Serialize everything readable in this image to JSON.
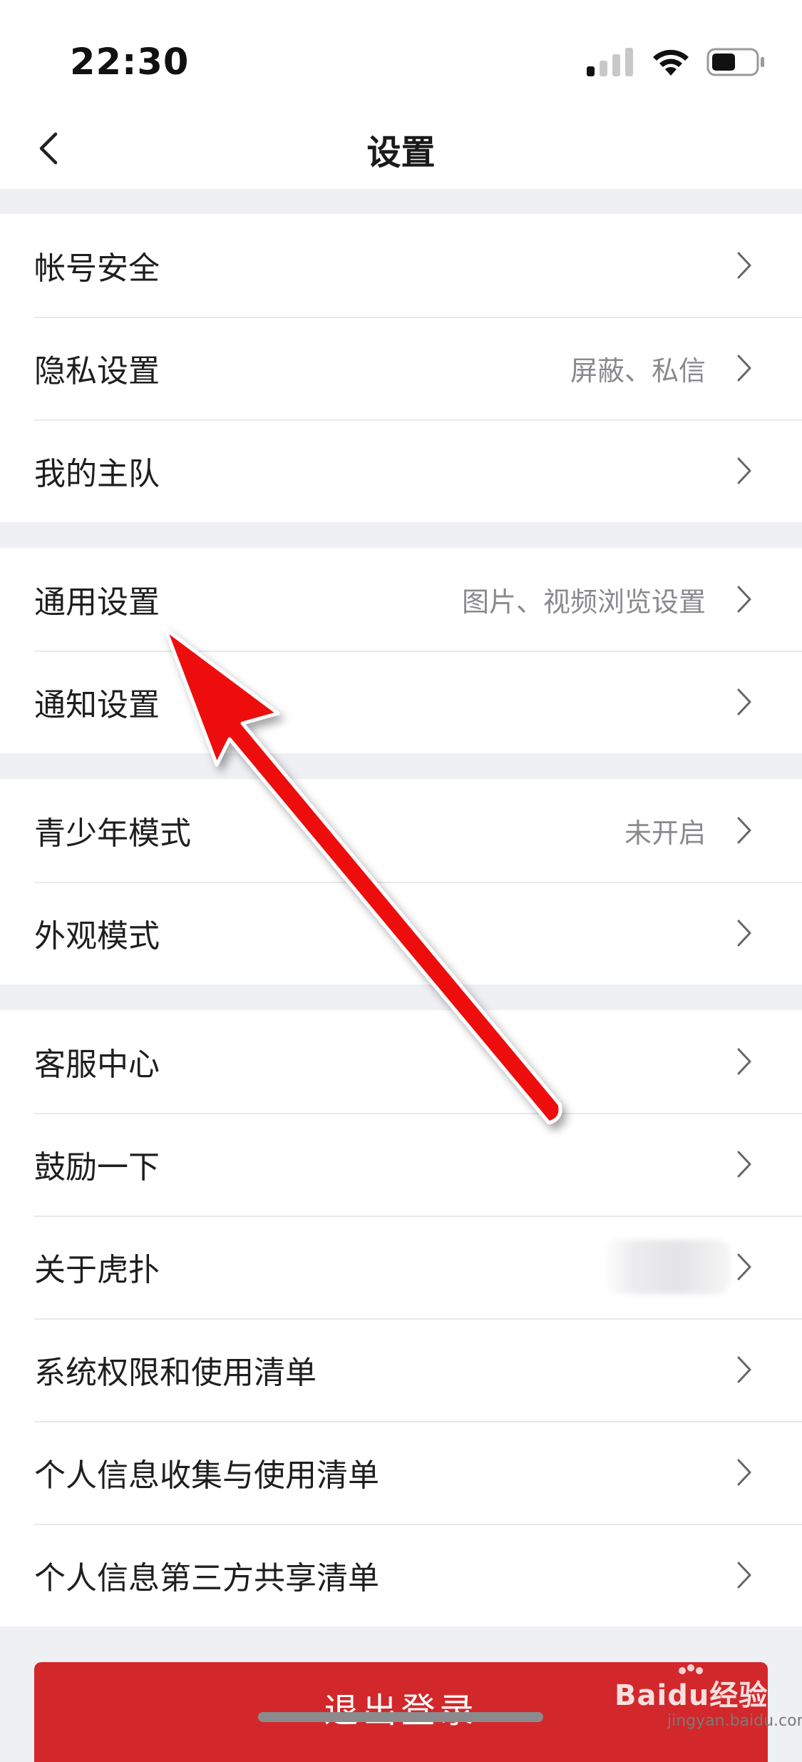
{
  "status": {
    "time": "22:30"
  },
  "nav": {
    "title": "设置"
  },
  "groups": [
    {
      "items": [
        {
          "label": "帐号安全",
          "value": ""
        },
        {
          "label": "隐私设置",
          "value": "屏蔽、私信"
        },
        {
          "label": "我的主队",
          "value": ""
        }
      ]
    },
    {
      "items": [
        {
          "label": "通用设置",
          "value": "图片、视频浏览设置"
        },
        {
          "label": "通知设置",
          "value": ""
        }
      ]
    },
    {
      "items": [
        {
          "label": "青少年模式",
          "value": "未开启"
        },
        {
          "label": "外观模式",
          "value": ""
        }
      ]
    },
    {
      "items": [
        {
          "label": "客服中心",
          "value": ""
        },
        {
          "label": "鼓励一下",
          "value": ""
        },
        {
          "label": "关于虎扑",
          "value": ""
        },
        {
          "label": "系统权限和使用清单",
          "value": ""
        },
        {
          "label": "个人信息收集与使用清单",
          "value": ""
        },
        {
          "label": "个人信息第三方共享清单",
          "value": ""
        }
      ]
    }
  ],
  "logout": {
    "label": "退出登录"
  },
  "watermark": {
    "brand": "Baidu经验",
    "url": "jingyan.baidu.com"
  },
  "colors": {
    "accent_red": "#d2282b",
    "annotation_arrow": "#ee1111",
    "background": "#eff0f4"
  }
}
